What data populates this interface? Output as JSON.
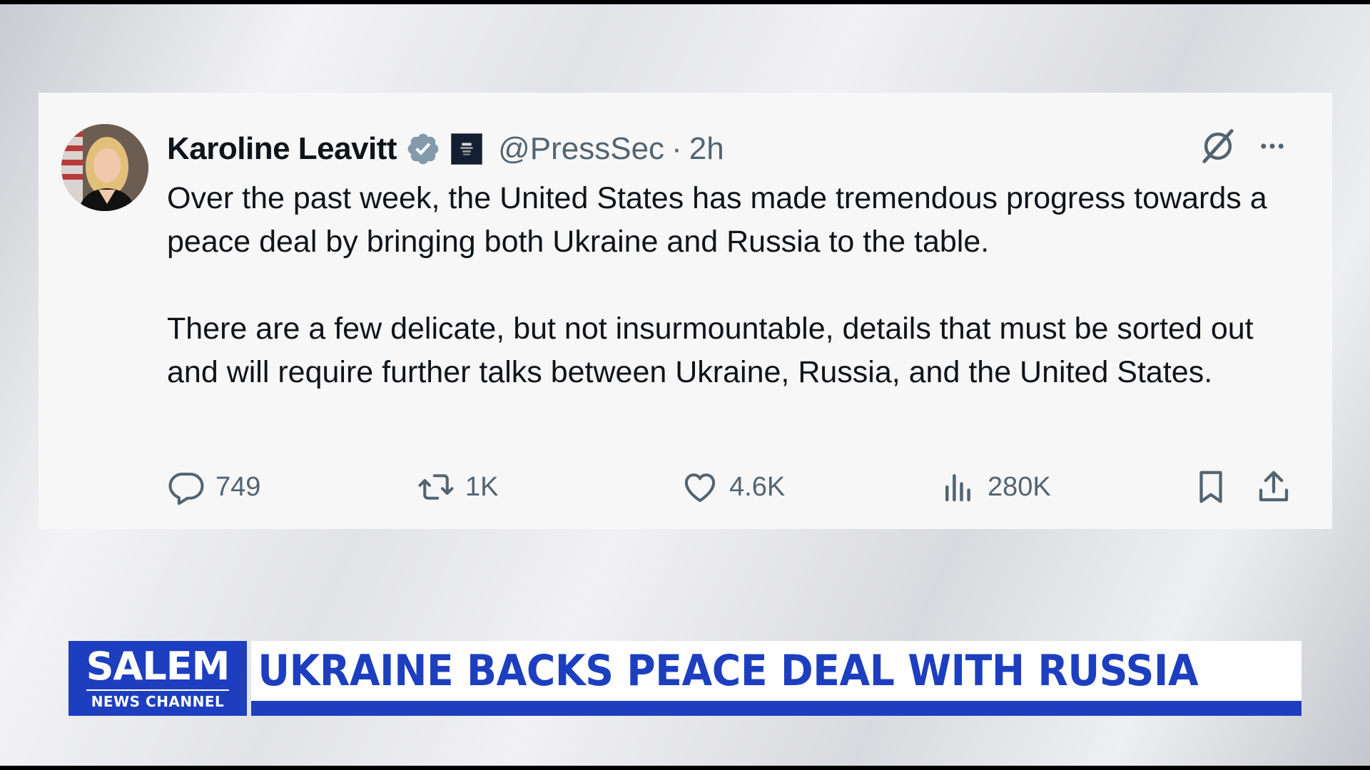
{
  "tweet": {
    "author_name": "Karoline Leavitt",
    "handle": "@PressSec",
    "separator": "·",
    "time": "2h",
    "paragraphs": [
      "Over the past week, the United States has made tremendous progress towards a peace deal by bringing both Ukraine and Russia to the table.",
      "There are a few delicate, but not insurmountable, details that must be sorted out and will require further talks between Ukraine, Russia, and the United States."
    ],
    "icons": {
      "verified": "verified-badge-icon",
      "affiliation": "white-house-affiliate-icon",
      "grok": "grok-icon",
      "more": "more-icon"
    },
    "actions": {
      "replies": "749",
      "reposts": "1K",
      "likes": "4.6K",
      "views": "280K"
    },
    "colors": {
      "verified": "#829aab",
      "text": "#0f1419",
      "muted": "#536471"
    }
  },
  "lower_third": {
    "logo_main": "SALEM",
    "logo_sub": "NEWS CHANNEL",
    "headline": "UKRAINE BACKS PEACE DEAL WITH RUSSIA",
    "colors": {
      "brand_blue": "#1d3fbf",
      "headline_bg": "#ffffff"
    }
  }
}
